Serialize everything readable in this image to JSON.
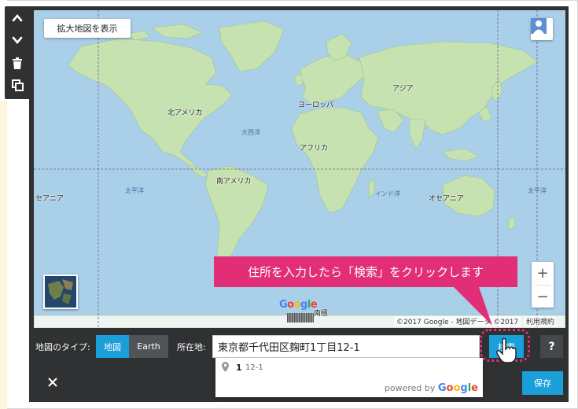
{
  "map": {
    "enlarge_label": "拡大地図を表示",
    "continents": [
      {
        "key": "north-america",
        "label": "北アメリカ"
      },
      {
        "key": "south-america",
        "label": "南アメリカ"
      },
      {
        "key": "europe",
        "label": "ヨーロッパ"
      },
      {
        "key": "asia",
        "label": "アジア"
      },
      {
        "key": "africa",
        "label": "アフリカ"
      },
      {
        "key": "oceania-right",
        "label": "オセアニア"
      },
      {
        "key": "oceania-left",
        "label": "セアニア"
      },
      {
        "key": "antarctica",
        "label": "南極"
      }
    ],
    "oceans": [
      {
        "key": "atlantic",
        "label": "大西洋"
      },
      {
        "key": "pacific-left",
        "label": "太平洋"
      },
      {
        "key": "indian",
        "label": "インド洋"
      },
      {
        "key": "pacific-right",
        "label": "太平洋"
      }
    ],
    "google_logo": "Google",
    "copyright": "©2017 Google - 地図データ ©2017",
    "terms": "利用規約",
    "zoom_in": "+",
    "zoom_out": "−"
  },
  "controls": {
    "map_type_label": "地図のタイプ:",
    "map_type_options": [
      "地図",
      "Earth"
    ],
    "address_label": "所在地:",
    "address_value": "東京都千代田区麹町1丁目12-1",
    "search_label": "検索",
    "help_label": "?",
    "save_label": "保存",
    "close_label": "×"
  },
  "suggestion": {
    "bold": "1",
    "rest": "12-1",
    "powered_by": "powered by",
    "powered_brand": "Google"
  },
  "callout": {
    "text": "住所を入力したら「検索」をクリックします"
  },
  "colors": {
    "accent": "#1a9fd9",
    "callout": "#e22e77",
    "editor_bg": "#2f3133",
    "water": "#a9cfe9",
    "land": "#c7e2b1"
  },
  "icons": {
    "toolbar": [
      "chevron-up-icon",
      "chevron-down-icon",
      "trash-icon",
      "copy-icon"
    ],
    "pegman": "pegman-icon",
    "pin": "map-pin-icon",
    "pointer": "hand-pointer-icon",
    "close": "close-icon"
  }
}
